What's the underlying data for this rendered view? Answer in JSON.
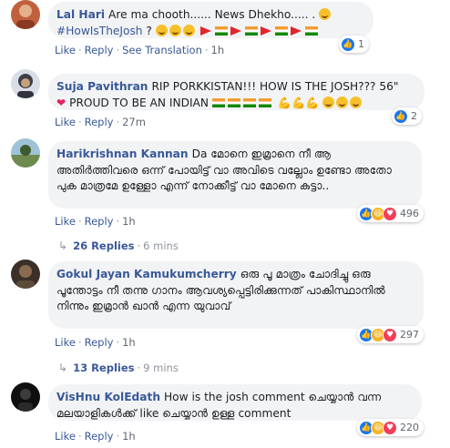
{
  "comments": [
    {
      "author": "Lal Hari",
      "text_parts": [
        "Are ma chooth...... News Dhekho..... . ",
        "#HowIsTheJosh",
        " ?"
      ],
      "like": "Like",
      "reply": "Reply",
      "translate": "See Translation",
      "time": "1h",
      "reaction_count": "1",
      "avatar_color": "#b8553a"
    },
    {
      "author": "Suja Pavithran",
      "text": "RIP PORKKISTAN!!! HOW IS THE JOSH??? 56\"",
      "text2": "PROUD TO BE AN INDIAN",
      "like": "Like",
      "reply": "Reply",
      "time": "27m",
      "reaction_count": "2",
      "avatar_color": "#3a3f4a"
    },
    {
      "author": "Harikrishnan Kannan",
      "text": "Da മോനെ ഇമ്രാനെ നീ ആ അതിർത്തിവരെ ഒന്ന് പോയിട്ട് വാ അവിടെ വല്ലോം ഉണ്ടോ അതോ പുക മാത്രമേ ഉള്ളോ എന്ന് നോക്കീട്ട് വാ മോനെ കുട്ടാ..",
      "like": "Like",
      "reply": "Reply",
      "time": "1h",
      "reaction_count": "496",
      "replies_count": "26 Replies",
      "replies_time": "6 mins",
      "avatar_color": "#6f8a4e"
    },
    {
      "author": "Gokul Jayan Kamukumcherry",
      "text": "ഒരു പൂ മാത്രം ചോദിച്ചു ഒരു പൂന്തോട്ടം നീ തന്നു ഗാനം ആവശ്യപ്പെട്ടിരിക്കുന്നത് പാകിസ്ഥാനിൽ നിന്നും ഇമ്രാൻ ഖാൻ എന്ന യുവാവ്",
      "like": "Like",
      "reply": "Reply",
      "time": "1h",
      "reaction_count": "297",
      "replies_count": "13 Replies",
      "replies_time": "9 mins",
      "avatar_color": "#5b4a3a"
    },
    {
      "author": "VisHnu KolEdath",
      "text": "How is the josh comment ചെയ്യാൻ വന്ന മലയാളികൾക്ക് like ചെയ്യാൻ ഉള്ള comment",
      "like": "Like",
      "reply": "Reply",
      "time": "1h",
      "reaction_count": "220",
      "avatar_color": "#1d1d1d"
    }
  ],
  "colors": {
    "link": "#385898",
    "bubble": "#f2f3f5",
    "meta": "#606770"
  }
}
